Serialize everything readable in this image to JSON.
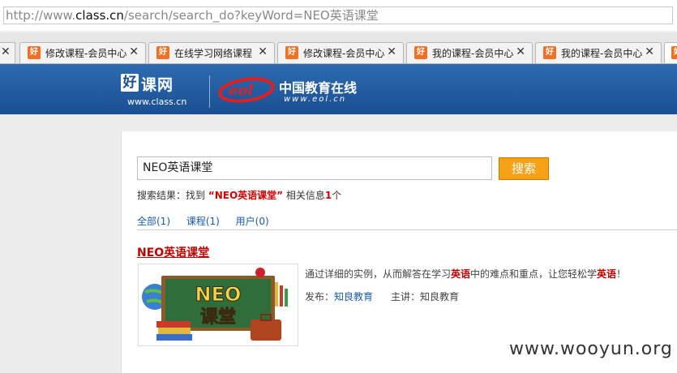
{
  "browser": {
    "address_prefix": "http://www.",
    "address_host": "class.cn",
    "address_path": "/search/search_do?keyWord=NEO英语课堂",
    "tabs": [
      {
        "label": "修改课程-会员中心"
      },
      {
        "label": "在线学习网络课程"
      },
      {
        "label": "修改课程-会员中心"
      },
      {
        "label": "我的课程-会员中心"
      },
      {
        "label": "我的课程-会员中心"
      }
    ],
    "favicon_glyph": "好",
    "close_glyph": "✕"
  },
  "header": {
    "logo_glyph": "好",
    "logo_text": "课网",
    "logo_url": "www.class.cn",
    "eol_title": "中国教育在线",
    "eol_url": "www.eol.cn",
    "banner_color": "#1a4f93"
  },
  "search": {
    "input_value": "NEO英语课堂",
    "button_label": "搜索",
    "summary_prefix": "搜索结果：找到 ",
    "summary_keyword": "“NEO英语课堂”",
    "summary_mid": " 相关信息",
    "summary_count": "1",
    "summary_suffix": "个",
    "accent_color": "#f7a114"
  },
  "filters": [
    {
      "label": "全部(1)"
    },
    {
      "label": "课程(1)"
    },
    {
      "label": "用户(0)"
    }
  ],
  "result": {
    "title": "NEO英语课堂",
    "thumbnail_text_line1": "NEO",
    "thumbnail_text_line2": "课堂",
    "desc_part1": "通过详细的实例，从而解答在学习",
    "desc_hl1": "英语",
    "desc_part2": "中的难点和重点，让您轻松学",
    "desc_hl2": "英语",
    "desc_part3": "！",
    "publisher_label": "发布：",
    "publisher_value": "知良教育",
    "lecturer_label": "主讲：",
    "lecturer_value": "知良教育"
  },
  "watermark": "www.wooyun.org"
}
